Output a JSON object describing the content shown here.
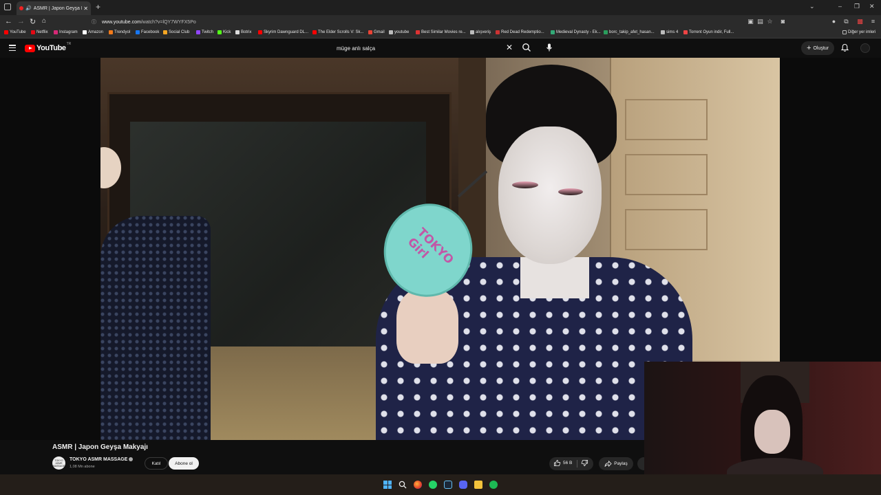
{
  "browser": {
    "tab_title": "ASMR | Japon Geyşa Makya",
    "url_host": "www.youtube.com",
    "url_path": "/watch?v=lQY7WYFX5Po",
    "bookmarks": [
      {
        "label": "YouTube",
        "color": "#ff0000"
      },
      {
        "label": "Netflix",
        "color": "#e50914"
      },
      {
        "label": "Instagram",
        "color": "#d62976"
      },
      {
        "label": "Amazon",
        "color": "#ffffff"
      },
      {
        "label": "Trendyol",
        "color": "#f27a1a"
      },
      {
        "label": "Facebook",
        "color": "#1877f2"
      },
      {
        "label": "Social Club",
        "color": "#f5a623"
      },
      {
        "label": "Twitch",
        "color": "#9146ff"
      },
      {
        "label": "Kick",
        "color": "#53fc18"
      },
      {
        "label": "Botrix",
        "color": "#dddddd"
      },
      {
        "label": "Skyrim Dawnguard DL...",
        "color": "#ff0000"
      },
      {
        "label": "The Elder Scrolls V: Sk...",
        "color": "#ff0000"
      },
      {
        "label": "Gmail",
        "color": "#ea4335"
      },
      {
        "label": "youtube",
        "color": "#bbbbbb"
      },
      {
        "label": "Best Similar Movies re...",
        "color": "#d33"
      },
      {
        "label": "alışveriş",
        "color": "#bbbbbb"
      },
      {
        "label": "Red Dead Redemptio...",
        "color": "#c33"
      },
      {
        "label": "Medieval Dynasty - Ek...",
        "color": "#3a7"
      },
      {
        "label": "borc_takip_afet_hasan...",
        "color": "#2a9d5c"
      },
      {
        "label": "sims 4",
        "color": "#bbbbbb"
      },
      {
        "label": "Torrent Oyun indir, Full...",
        "color": "#e44"
      }
    ],
    "other_bookmarks": "Diğer yer imleri"
  },
  "youtube": {
    "logo_text": "YouTube",
    "logo_region": "TR",
    "search_query": "müge anlı salça",
    "create_label": "Oluştur"
  },
  "video": {
    "mirror_text": "TOKYO Girl",
    "title": "ASMR | Japon Geyşa Makyajı",
    "channel_name": "TOKYO ASMR MASSAGE",
    "channel_avatar_text": "TOKYO ASMR MASSAGE",
    "subscribers": "1,08 Mn abone",
    "join_label": "Katıl",
    "subscribe_label": "Abone ol",
    "likes": "56 B",
    "share_label": "Paylaş"
  },
  "colors": {
    "youtube_red": "#ff0000",
    "background": "#0f0f0f",
    "chip": "#272727"
  }
}
